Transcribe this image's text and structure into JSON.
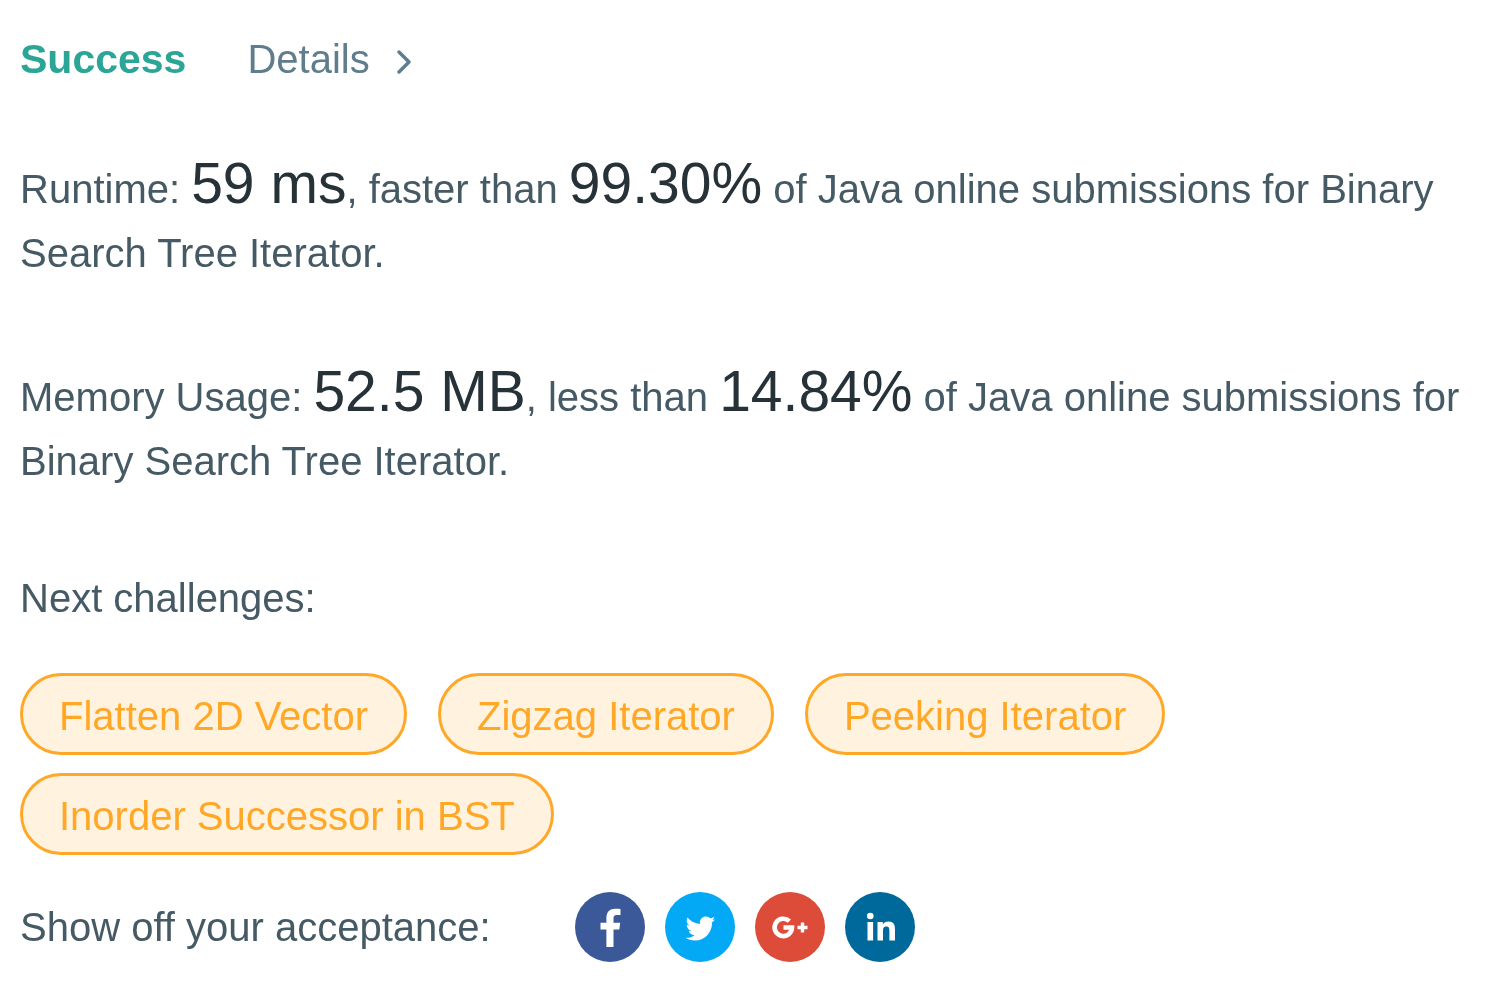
{
  "header": {
    "status": "Success",
    "details_link": "Details"
  },
  "results": [
    {
      "segments": [
        {
          "kind": "plain",
          "text": "Runtime: "
        },
        {
          "kind": "figure",
          "text": "59 ms"
        },
        {
          "kind": "plain",
          "text": ", faster than "
        },
        {
          "kind": "figure",
          "text": "99.30%"
        },
        {
          "kind": "plain",
          "text": " of Java online submissions for Binary Search Tree Iterator."
        }
      ]
    },
    {
      "segments": [
        {
          "kind": "plain",
          "text": "Memory Usage: "
        },
        {
          "kind": "figure",
          "text": "52.5 MB"
        },
        {
          "kind": "plain",
          "text": ", less than "
        },
        {
          "kind": "figure",
          "text": "14.84%"
        },
        {
          "kind": "plain",
          "text": " of Java online submissions for Binary Search Tree Iterator."
        }
      ]
    }
  ],
  "next_challenges": {
    "label": "Next challenges:",
    "items": [
      "Flatten 2D Vector",
      "Zigzag Iterator",
      "Peeking Iterator",
      "Inorder Successor in BST"
    ]
  },
  "share": {
    "label": "Show off your acceptance:",
    "buttons": [
      {
        "kind": "facebook"
      },
      {
        "kind": "twitter"
      },
      {
        "kind": "google_plus"
      },
      {
        "kind": "linkedin"
      }
    ]
  }
}
